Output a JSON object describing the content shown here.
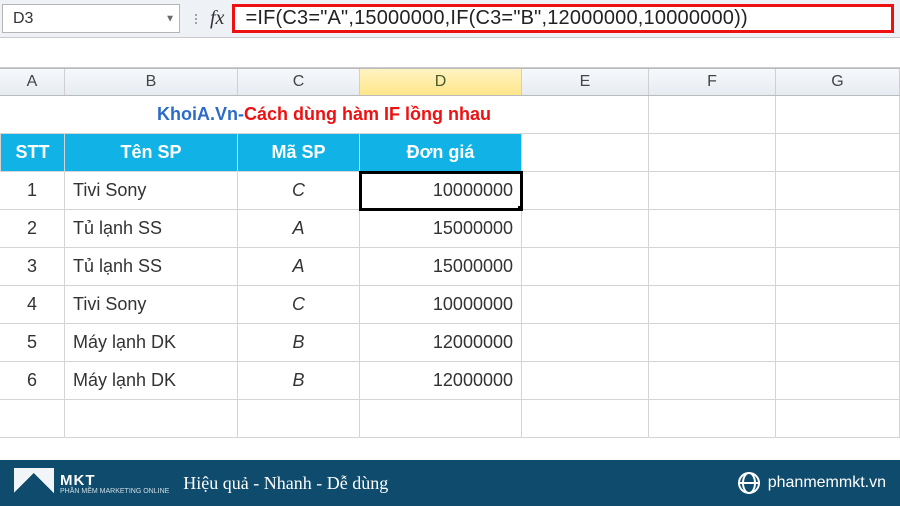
{
  "formula_bar": {
    "cell_ref": "D3",
    "fx_label": "fx",
    "formula": "=IF(C3=\"A\",15000000,IF(C3=\"B\",12000000,10000000))"
  },
  "column_headers": [
    "A",
    "B",
    "C",
    "D",
    "E",
    "F",
    "G"
  ],
  "active_column_index": 3,
  "title": {
    "blue": "KhoiA.Vn",
    "sep": " - ",
    "red": "Cách dùng hàm IF lồng nhau"
  },
  "table_headers": [
    "STT",
    "Tên SP",
    "Mã SP",
    "Đơn giá"
  ],
  "rows": [
    {
      "stt": "1",
      "name": "Tivi Sony",
      "code": "C",
      "price": "10000000"
    },
    {
      "stt": "2",
      "name": "Tủ lạnh SS",
      "code": "A",
      "price": "15000000"
    },
    {
      "stt": "3",
      "name": "Tủ lạnh SS",
      "code": "A",
      "price": "15000000"
    },
    {
      "stt": "4",
      "name": "Tivi Sony",
      "code": "C",
      "price": "10000000"
    },
    {
      "stt": "5",
      "name": "Máy lạnh DK",
      "code": "B",
      "price": "12000000"
    },
    {
      "stt": "6",
      "name": "Máy lạnh DK",
      "code": "B",
      "price": "12000000"
    }
  ],
  "footer": {
    "brand": "MKT",
    "brand_sub": "PHẦN MỀM MARKETING ONLINE",
    "tagline": "Hiệu quả - Nhanh - Dễ dùng",
    "url": "phanmemmkt.vn"
  }
}
